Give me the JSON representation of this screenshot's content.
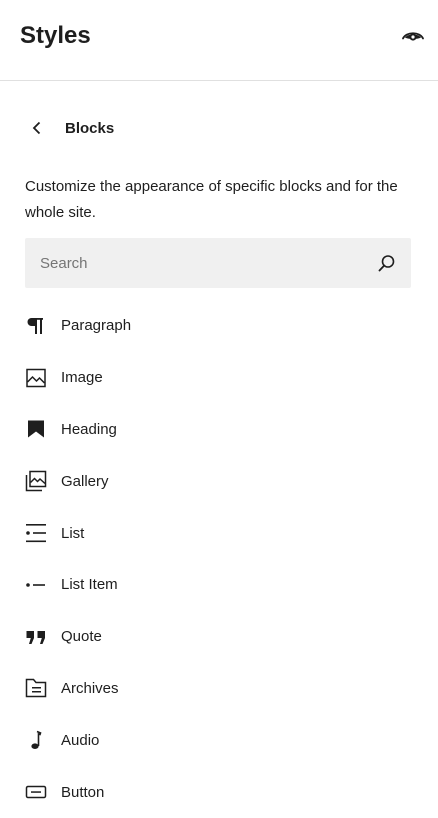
{
  "header": {
    "title": "Styles",
    "preview_icon": "eye-icon"
  },
  "nav": {
    "back_icon": "chevron-left-icon",
    "title": "Blocks"
  },
  "description": "Customize the appearance of specific blocks and for the whole site.",
  "search": {
    "placeholder": "Search",
    "value": "",
    "icon": "search-icon"
  },
  "blocks": [
    {
      "label": "Paragraph",
      "icon": "paragraph-icon"
    },
    {
      "label": "Image",
      "icon": "image-icon"
    },
    {
      "label": "Heading",
      "icon": "heading-icon"
    },
    {
      "label": "Gallery",
      "icon": "gallery-icon"
    },
    {
      "label": "List",
      "icon": "list-icon"
    },
    {
      "label": "List Item",
      "icon": "list-item-icon"
    },
    {
      "label": "Quote",
      "icon": "quote-icon"
    },
    {
      "label": "Archives",
      "icon": "archives-icon"
    },
    {
      "label": "Audio",
      "icon": "audio-icon"
    },
    {
      "label": "Button",
      "icon": "button-icon"
    }
  ],
  "colors": {
    "text": "#1e1e1e",
    "search_bg": "#f0f0f0",
    "placeholder": "#757575",
    "divider": "#e0e0e0"
  }
}
